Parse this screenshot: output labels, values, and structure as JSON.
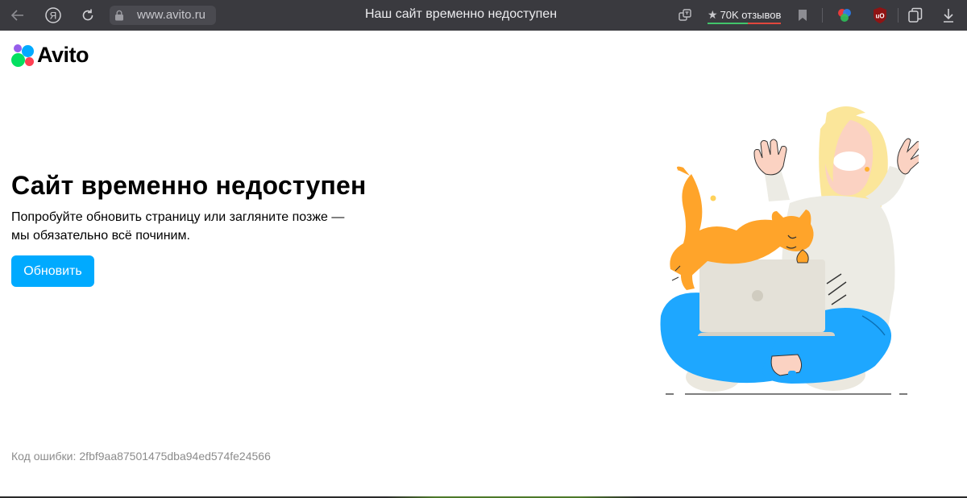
{
  "browser": {
    "url": "www.avito.ru",
    "tab_title": "Наш сайт временно недоступен",
    "reviews_label": "70K отзывов"
  },
  "page": {
    "logo_text": "Avito",
    "headline": "Сайт временно недоступен",
    "subtext_line1": "Попробуйте обновить страницу или загляните позже —",
    "subtext_line2": "мы обязательно всё починим.",
    "refresh_button": "Обновить",
    "error_label": "Код ошибки:",
    "error_code": "2fbf9aa87501475dba94ed574fe24566"
  },
  "colors": {
    "accent": "#00aaff",
    "browser_bar": "#3a3a3f",
    "logo_dots": [
      "#04e061",
      "#965eeb",
      "#0af",
      "#ff4053"
    ]
  },
  "icons": [
    "back-arrow-icon",
    "yandex-icon",
    "reload-icon",
    "lock-icon",
    "translate-icon",
    "star-icon",
    "bookmark-icon",
    "extension-icon",
    "ublock-icon",
    "collections-icon",
    "download-icon"
  ]
}
